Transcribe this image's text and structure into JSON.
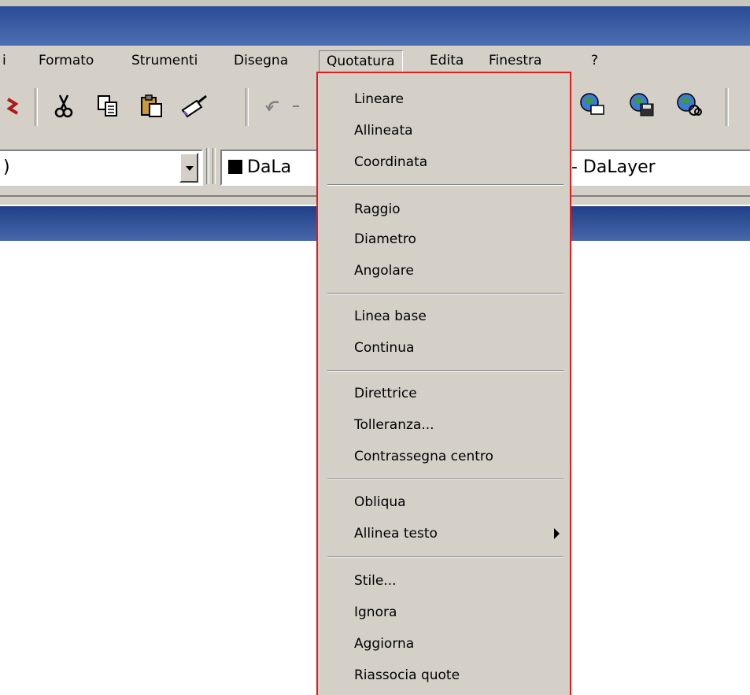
{
  "menubar": {
    "items": [
      {
        "label": "i"
      },
      {
        "label": "Formato"
      },
      {
        "label": "Strumenti"
      },
      {
        "label": "Disegna"
      },
      {
        "label": "Quotatura"
      },
      {
        "label": "Edita"
      },
      {
        "label": "Finestra"
      },
      {
        "label": "?"
      }
    ]
  },
  "toolbar": {
    "icons": [
      "cut-icon",
      "copy-icon",
      "paste-icon",
      "match-properties-icon",
      "undo-icon",
      "print-preview-icon",
      "save-icon",
      "web-icon"
    ]
  },
  "properties_bar": {
    "layer_combo_value": ")",
    "color_combo_value": "DaLa",
    "linetype_combo_value": "- DaLayer"
  },
  "dropdown": {
    "items": [
      {
        "label": "Lineare"
      },
      {
        "label": "Allineata"
      },
      {
        "label": "Coordinata"
      },
      {
        "label": "Raggio"
      },
      {
        "label": "Diametro"
      },
      {
        "label": "Angolare"
      },
      {
        "label": "Linea base"
      },
      {
        "label": "Continua"
      },
      {
        "label": "Direttrice"
      },
      {
        "label": "Tolleranza..."
      },
      {
        "label": "Contrassegna centro"
      },
      {
        "label": "Obliqua"
      },
      {
        "label": "Allinea testo"
      },
      {
        "label": "Stile..."
      },
      {
        "label": "Ignora"
      },
      {
        "label": "Aggiorna"
      },
      {
        "label": "Riassocia quote"
      }
    ]
  },
  "colors": {
    "titlebar": "#2a4c96",
    "menu_background": "#d4d0c8",
    "highlight_border": "#e11c1c"
  }
}
